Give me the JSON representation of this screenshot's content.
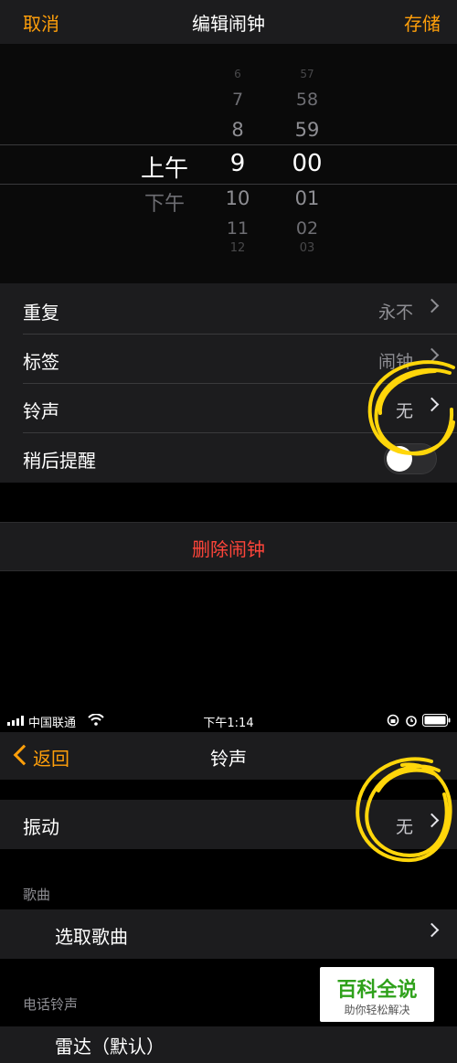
{
  "edit_alarm": {
    "nav": {
      "cancel": "取消",
      "title": "编辑闹钟",
      "save": "存储"
    },
    "picker": {
      "ampm": [
        "上午",
        "下午"
      ],
      "hours": [
        "6",
        "7",
        "8",
        "9",
        "10",
        "11",
        "12"
      ],
      "minutes": [
        "57",
        "58",
        "59",
        "00",
        "01",
        "02",
        "03"
      ],
      "selected": {
        "ampm": "上午",
        "hour": "9",
        "minute": "00"
      }
    },
    "rows": [
      {
        "label": "重复",
        "value": "永不"
      },
      {
        "label": "标签",
        "value": "闹钟"
      },
      {
        "label": "铃声",
        "value": "无"
      },
      {
        "label": "稍后提醒",
        "toggle": false
      }
    ],
    "delete_label": "删除闹钟"
  },
  "ringtone": {
    "status_bar": {
      "carrier": "中国联通",
      "time": "下午1:14"
    },
    "nav": {
      "back": "返回",
      "title": "铃声"
    },
    "vibration": {
      "label": "振动",
      "value": "无"
    },
    "songs_header": "歌曲",
    "pick_song": "选取歌曲",
    "tones_header": "电话铃声",
    "first_tone": "雷达（默认）"
  },
  "watermark": {
    "title": "百科全说",
    "subtitle": "助你轻松解决"
  },
  "colors": {
    "accent": "#ff9f0a",
    "destructive": "#ff453a",
    "highlight_scribble": "#ffd60a"
  }
}
